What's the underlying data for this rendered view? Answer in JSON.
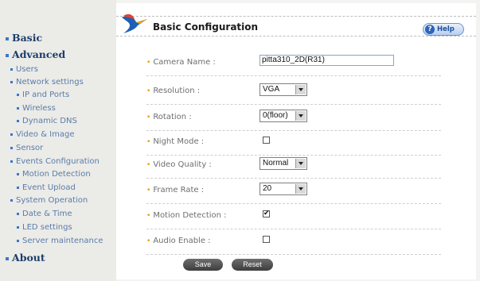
{
  "sidebar": {
    "basic": "Basic",
    "advanced": "Advanced",
    "items": [
      {
        "label": "Users",
        "level": 1
      },
      {
        "label": "Network settings",
        "level": 1
      },
      {
        "label": "IP and Ports",
        "level": 2
      },
      {
        "label": "Wireless",
        "level": 2
      },
      {
        "label": "Dynamic DNS",
        "level": 2
      },
      {
        "label": "Video & Image",
        "level": 1
      },
      {
        "label": "Sensor",
        "level": 1
      },
      {
        "label": "Events Configuration",
        "level": 1
      },
      {
        "label": "Motion Detection",
        "level": 2
      },
      {
        "label": "Event Upload",
        "level": 2
      },
      {
        "label": "System Operation",
        "level": 1
      },
      {
        "label": "Date & Time",
        "level": 2
      },
      {
        "label": "LED settings",
        "level": 2
      },
      {
        "label": "Server maintenance",
        "level": 2
      }
    ],
    "about": "About"
  },
  "header": {
    "title": "Basic Configuration",
    "help_label": "Help",
    "help_icon": "?"
  },
  "form": {
    "camera_name": {
      "label": "Camera Name :",
      "value": "pitta310_2D(R31)"
    },
    "resolution": {
      "label": "Resolution :",
      "value": "VGA"
    },
    "rotation": {
      "label": "Rotation :",
      "value": "0(floor)"
    },
    "night_mode": {
      "label": "Night Mode :",
      "checked": false,
      "mark": ""
    },
    "video_quality": {
      "label": "Video Quality :",
      "value": "Normal"
    },
    "frame_rate": {
      "label": "Frame Rate :",
      "value": "20"
    },
    "motion_detection": {
      "label": "Motion Detection :",
      "checked": true,
      "mark": "✔"
    },
    "audio_enable": {
      "label": "Audio Enable :",
      "checked": false,
      "mark": ""
    }
  },
  "buttons": {
    "save": "Save",
    "reset": "Reset"
  },
  "colors": {
    "nav_heading": "#1d3d6b",
    "nav_link": "#5b7ca8",
    "bullet": "#e0a000",
    "button": "#4a4a4a"
  }
}
